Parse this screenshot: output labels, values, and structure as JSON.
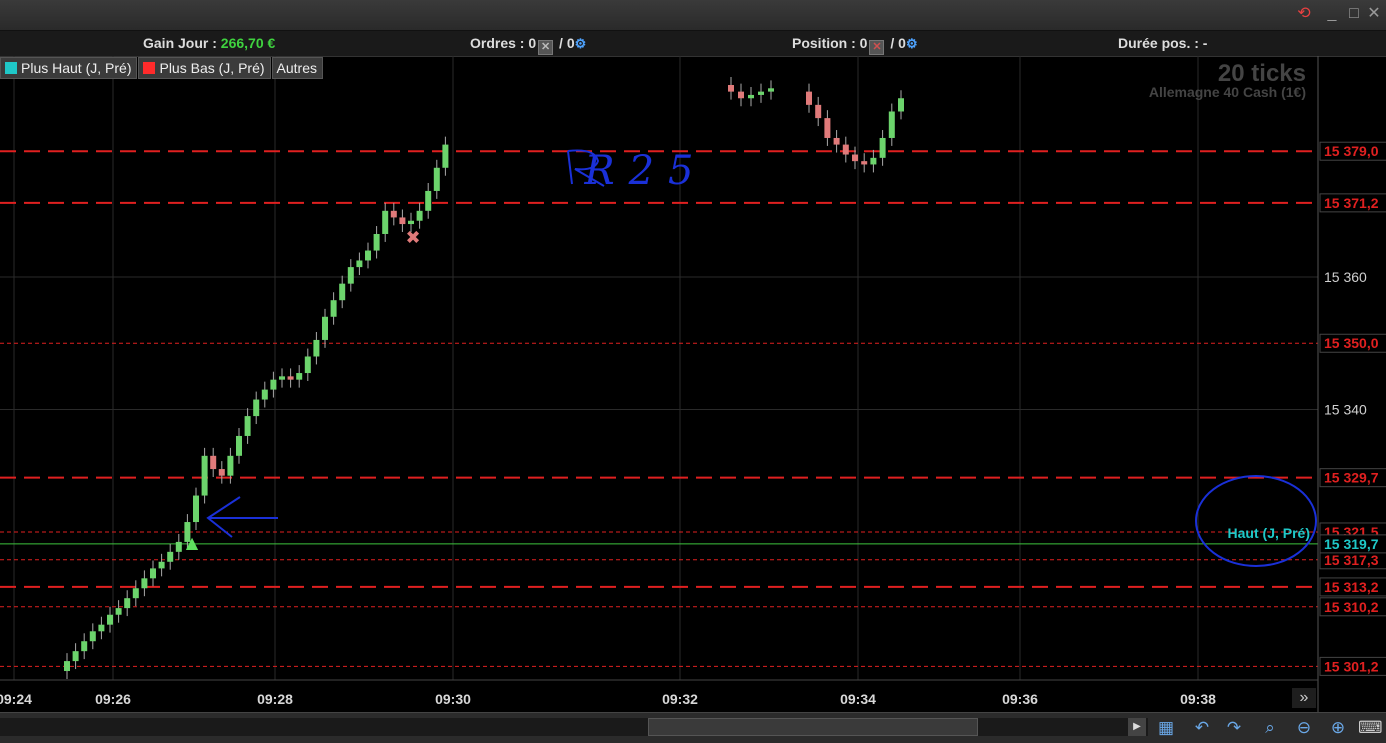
{
  "window": {
    "controls": [
      "_",
      "□",
      "✕"
    ]
  },
  "infobar": {
    "gain_label": "Gain Jour :",
    "gain_value": "266,70 €",
    "orders_label": "Ordres :",
    "orders_count": "0",
    "orders_sep": "/ 0",
    "position_label": "Position :",
    "position_count": "0",
    "position_sep": "/ 0",
    "duration_label": "Durée pos. : -"
  },
  "legend": {
    "items": [
      {
        "label": "Plus Haut (J, Pré)",
        "color": "#1fc8c8"
      },
      {
        "label": "Plus Bas (J, Pré)",
        "color": "#ff2b2b"
      },
      {
        "label": "Autres",
        "color": ""
      }
    ]
  },
  "watermark": {
    "ticks": "20 ticks",
    "instrument": "Allemagne 40 Cash (1€)"
  },
  "annotations": {
    "handwritten_text": "R25",
    "circled_label": "Haut (J, Pré)"
  },
  "colors": {
    "up": "#6cd46c",
    "down": "#e07a7a",
    "level_line": "#e02020",
    "haut_line": "#3ec43e",
    "pen": "#1a30d8"
  },
  "chart_data": {
    "type": "candlestick",
    "xlabel": "",
    "ylabel": "",
    "x_ticks": [
      "09:24",
      "09:26",
      "09:28",
      "09:30",
      "09:32",
      "09:34",
      "09:36",
      "09:38"
    ],
    "y_ticks": [
      "15 360",
      "15 340"
    ],
    "y_tick_values": [
      15360,
      15340
    ],
    "ylim": [
      15299.9,
      15389.0
    ],
    "price_levels": [
      {
        "label": "15 379,0",
        "value": 15379.0,
        "style": "long-dash"
      },
      {
        "label": "15 371,2",
        "value": 15371.2,
        "style": "long-dash"
      },
      {
        "label": "15 350,0",
        "value": 15350.0,
        "style": "short-dash"
      },
      {
        "label": "15 329,7",
        "value": 15329.7,
        "style": "long-dash"
      },
      {
        "label": "15 321,5",
        "value": 15321.5,
        "style": "short-dash"
      },
      {
        "label": "15 317,3",
        "value": 15317.3,
        "style": "short-dash"
      },
      {
        "label": "15 313,2",
        "value": 15313.2,
        "style": "long-dash"
      },
      {
        "label": "15 310,2",
        "value": 15310.2,
        "style": "short-dash"
      },
      {
        "label": "15 301,2",
        "value": 15301.2,
        "style": "short-dash"
      }
    ],
    "haut_level": {
      "label": "15 319,7",
      "value": 15319.7
    },
    "series": [
      {
        "close": 15302.0
      },
      {
        "close": 15303.5
      },
      {
        "close": 15305.0
      },
      {
        "close": 15306.5
      },
      {
        "close": 15307.5
      },
      {
        "close": 15309.0
      },
      {
        "close": 15310.0
      },
      {
        "close": 15311.5
      },
      {
        "close": 15313.0
      },
      {
        "close": 15314.5
      },
      {
        "close": 15316.0
      },
      {
        "close": 15317.0
      },
      {
        "close": 15318.5
      },
      {
        "close": 15320.0
      },
      {
        "close": 15323.0
      },
      {
        "close": 15327.0
      },
      {
        "close": 15333.0
      },
      {
        "close": 15331.0
      },
      {
        "close": 15330.0
      },
      {
        "close": 15333.0
      },
      {
        "close": 15336.0
      },
      {
        "close": 15339.0
      },
      {
        "close": 15341.5
      },
      {
        "close": 15343.0
      },
      {
        "close": 15344.5
      },
      {
        "close": 15345.0
      },
      {
        "close": 15344.5
      },
      {
        "close": 15345.5
      },
      {
        "close": 15348.0
      },
      {
        "close": 15350.5
      },
      {
        "close": 15354.0
      },
      {
        "close": 15356.5
      },
      {
        "close": 15359.0
      },
      {
        "close": 15361.5
      },
      {
        "close": 15362.5
      },
      {
        "close": 15364.0
      },
      {
        "close": 15366.5
      },
      {
        "close": 15370.0
      },
      {
        "close": 15369.0
      },
      {
        "close": 15368.0
      },
      {
        "close": 15368.5
      },
      {
        "close": 15370.0
      },
      {
        "close": 15373.0
      },
      {
        "close": 15376.5
      },
      {
        "close": 15380.0
      }
    ],
    "series_b": [
      {
        "close": 15388.0
      },
      {
        "close": 15387.0
      },
      {
        "close": 15387.5
      },
      {
        "close": 15388.0
      },
      {
        "close": 15388.5
      }
    ],
    "series_c": [
      {
        "close": 15386.0
      },
      {
        "close": 15384.0
      },
      {
        "close": 15381.0
      },
      {
        "close": 15380.0
      },
      {
        "close": 15378.5
      },
      {
        "close": 15377.5
      },
      {
        "close": 15377.0
      },
      {
        "close": 15378.0
      },
      {
        "close": 15381.0
      },
      {
        "close": 15385.0
      },
      {
        "close": 15387.0
      }
    ]
  }
}
